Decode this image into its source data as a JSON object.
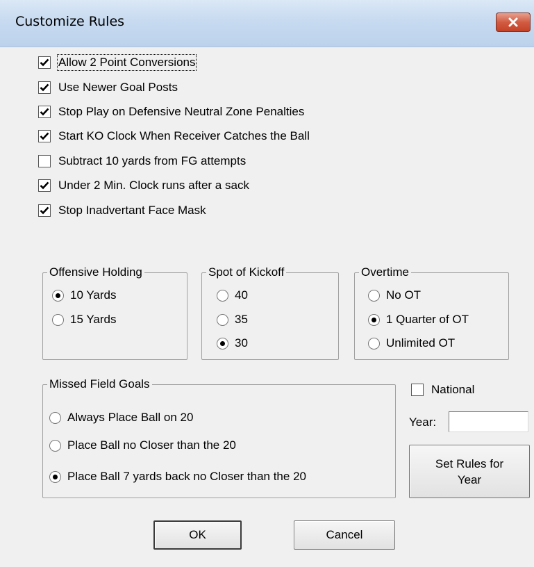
{
  "window": {
    "title": "Customize Rules"
  },
  "checkboxes": [
    {
      "label": "Allow 2 Point Conversions",
      "checked": true
    },
    {
      "label": "Use Newer Goal Posts",
      "checked": true
    },
    {
      "label": "Stop Play on Defensive Neutral Zone Penalties",
      "checked": true
    },
    {
      "label": "Start KO Clock When Receiver Catches the Ball",
      "checked": true
    },
    {
      "label": "Subtract 10 yards from FG attempts",
      "checked": false
    },
    {
      "label": "Under 2 Min. Clock runs after a sack",
      "checked": true
    },
    {
      "label": "Stop Inadvertant Face Mask",
      "checked": true
    }
  ],
  "offensive_holding": {
    "title": "Offensive Holding",
    "options": [
      {
        "label": "10 Yards",
        "selected": true
      },
      {
        "label": "15 Yards",
        "selected": false
      }
    ]
  },
  "spot_of_kickoff": {
    "title": "Spot of Kickoff",
    "options": [
      {
        "label": "40",
        "selected": false
      },
      {
        "label": "35",
        "selected": false
      },
      {
        "label": "30",
        "selected": true
      }
    ]
  },
  "overtime": {
    "title": "Overtime",
    "options": [
      {
        "label": "No OT",
        "selected": false
      },
      {
        "label": "1 Quarter of OT",
        "selected": true
      },
      {
        "label": "Unlimited OT",
        "selected": false
      }
    ]
  },
  "missed_field_goals": {
    "title": "Missed Field Goals",
    "options": [
      {
        "label": "Always Place Ball on 20",
        "selected": false
      },
      {
        "label": "Place Ball no Closer than the 20",
        "selected": false
      },
      {
        "label": "Place Ball 7 yards back no Closer than the 20",
        "selected": true
      }
    ]
  },
  "national": {
    "label": "National",
    "checked": false
  },
  "year": {
    "label": "Year:",
    "value": ""
  },
  "buttons": {
    "set_rules": "Set Rules for Year",
    "ok": "OK",
    "cancel": "Cancel"
  },
  "colors": {
    "dialog_bg": "#f0f0f0",
    "titlebar": "#c7daf0",
    "close_button": "#c44227"
  }
}
